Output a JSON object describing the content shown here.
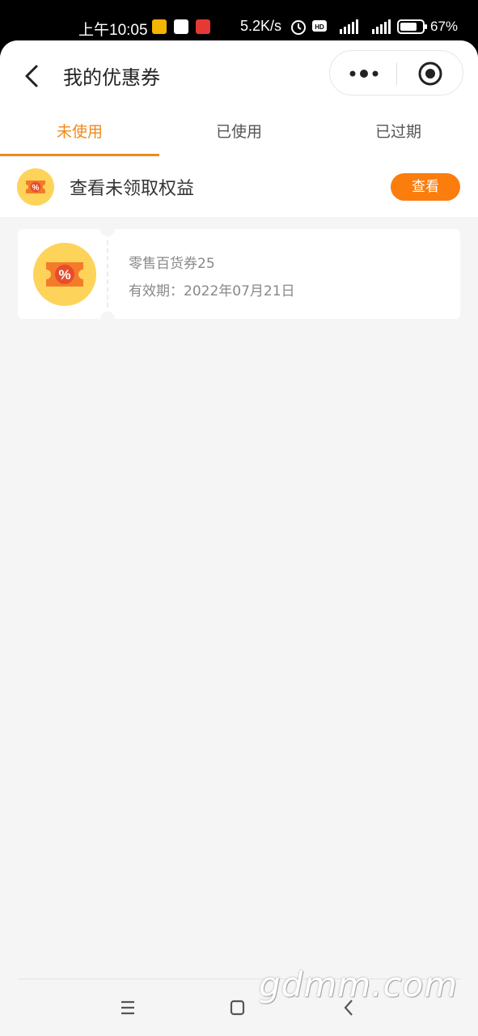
{
  "status_bar": {
    "time": "上午10:05",
    "net_speed": "5.2K/s",
    "battery": "67%"
  },
  "header": {
    "title": "我的优惠券"
  },
  "tabs": [
    {
      "label": "未使用",
      "active": true
    },
    {
      "label": "已使用",
      "active": false
    },
    {
      "label": "已过期",
      "active": false
    }
  ],
  "benefit": {
    "text": "查看未领取权益",
    "button_label": "查看"
  },
  "coupons": [
    {
      "name": "零售百货券25",
      "validity": "有效期：2022年07月21日"
    }
  ],
  "watermark": "gdmm.com",
  "colors": {
    "accent": "#f08a1a",
    "button": "#fb7d0d",
    "background": "#f5f5f5"
  }
}
